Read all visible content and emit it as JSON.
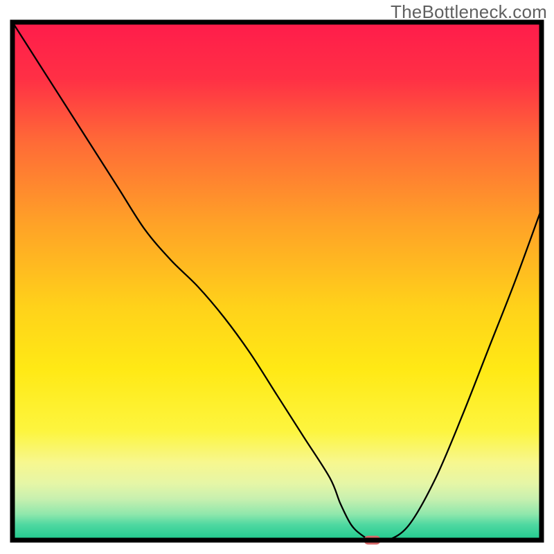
{
  "watermark": "TheBottleneck.com",
  "chart_data": {
    "type": "line",
    "title": "",
    "xlabel": "",
    "ylabel": "",
    "xlim": [
      0,
      100
    ],
    "ylim": [
      0,
      100
    ],
    "grid": false,
    "background": {
      "gradient_stops": [
        {
          "offset": 0,
          "color": "#ff1c4b"
        },
        {
          "offset": 11,
          "color": "#ff3045"
        },
        {
          "offset": 23,
          "color": "#ff6a37"
        },
        {
          "offset": 39,
          "color": "#ffa227"
        },
        {
          "offset": 55,
          "color": "#ffd21a"
        },
        {
          "offset": 67,
          "color": "#ffe915"
        },
        {
          "offset": 79,
          "color": "#fdf53f"
        },
        {
          "offset": 85,
          "color": "#f7f78f"
        },
        {
          "offset": 89,
          "color": "#e6f6a6"
        },
        {
          "offset": 92,
          "color": "#c8f0af"
        },
        {
          "offset": 95,
          "color": "#8fe7ac"
        },
        {
          "offset": 97,
          "color": "#4fd8a1"
        },
        {
          "offset": 100,
          "color": "#1fc98d"
        }
      ]
    },
    "series": [
      {
        "name": "bottleneck-curve",
        "color": "#000000",
        "x": [
          0,
          5,
          10,
          15,
          20,
          25,
          30,
          35,
          40,
          45,
          50,
          55,
          60,
          62,
          64,
          66,
          68,
          71,
          75,
          80,
          85,
          90,
          95,
          100
        ],
        "y": [
          100,
          92,
          84,
          76,
          68,
          60,
          54,
          49,
          43,
          36,
          28,
          20,
          12,
          7,
          3,
          1,
          0,
          0,
          3,
          12,
          24,
          37,
          50,
          64
        ]
      }
    ],
    "marker": {
      "name": "optimal-point",
      "shape": "rounded-rect",
      "color": "#d86a6a",
      "x": 68,
      "y": 0,
      "width_pct": 3.2,
      "height_pct": 1.7
    }
  }
}
